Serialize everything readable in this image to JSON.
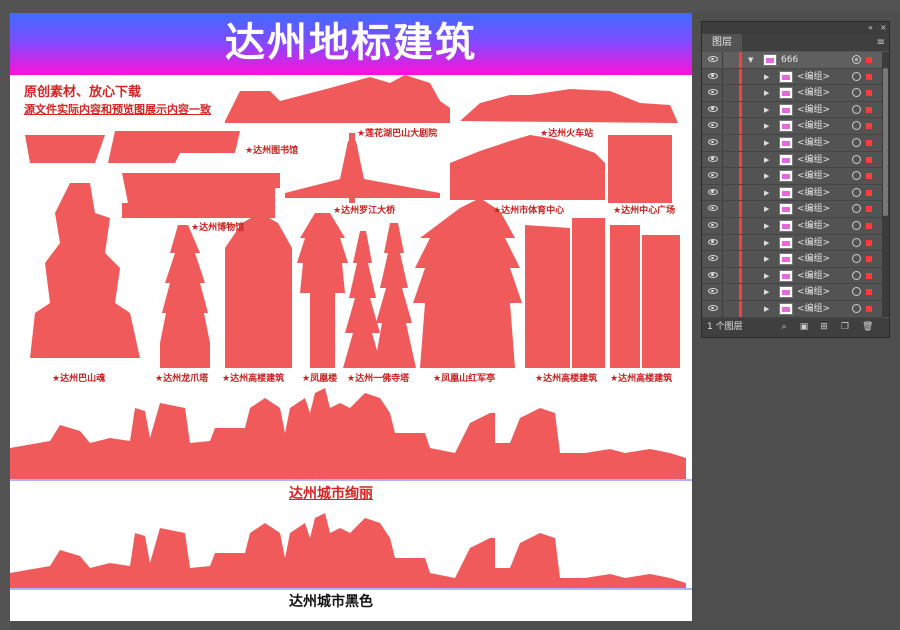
{
  "artboard": {
    "title": "达州地标建筑",
    "notes": [
      "原创素材、放心下载",
      "源文件实际内容和预览图展示内容一致"
    ],
    "silhouette_color": "#f05a5a",
    "banner_gradient": [
      "#3f6cff",
      "#7d4cff",
      "#ff10d8"
    ],
    "captions": [
      "★莲花湖巴山大剧院",
      "★达州火车站",
      "★达州图书馆",
      "★达州罗江大桥",
      "★达州市体育中心",
      "★达州中心广场",
      "★达州博物馆",
      "★达州巴山魂",
      "★达州龙爪塔",
      "★达州高楼建筑",
      "★凤凰楼",
      "★达州一佛寺塔",
      "★凤凰山红军亭",
      "★达州高楼建筑",
      "★达州高楼建筑"
    ],
    "skyline_color_caption": "达州城市绚丽",
    "skyline_black_caption": "达州城市黑色"
  },
  "layers_panel": {
    "tab": "图层",
    "collapse_icon": "double-chevron-icon",
    "close_icon": "close-icon",
    "menu_icon": "panel-menu-icon",
    "top_layer": "666",
    "sublayer_label": "<编组>",
    "sublayer_count": 16,
    "layer_count_text": "1 个图层",
    "bottom_icons": [
      "locate-object-icon",
      "make-clipping-mask-icon",
      "create-sublayer-icon",
      "create-layer-icon",
      "delete-icon"
    ],
    "highlight_color": "#ff3b3b"
  }
}
